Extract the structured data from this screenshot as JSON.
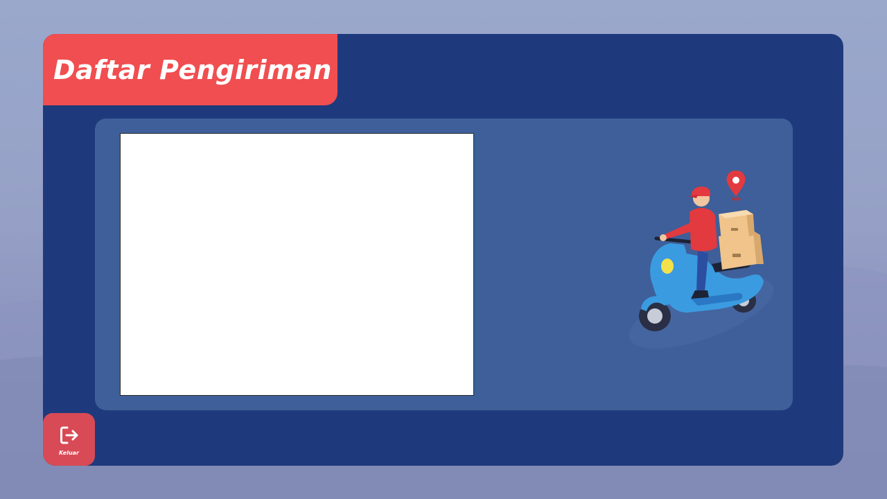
{
  "page": {
    "title": "Daftar Pengiriman"
  },
  "content": {
    "list_area": "",
    "illustration": "delivery-scooter-icon"
  },
  "logout": {
    "label": "Keluar",
    "icon": "logout-icon"
  },
  "colors": {
    "background": "#9aa8cc",
    "main_panel": "#1f3a7c",
    "content_panel": "#3e5f99",
    "title_tab": "#f04e50",
    "logout_button": "#d84a55"
  }
}
